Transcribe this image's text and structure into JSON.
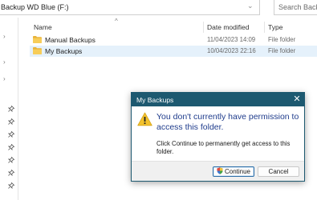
{
  "address": {
    "path": "Backup WD Blue (F:)",
    "dropdown_icon": "chevron-down-icon"
  },
  "search": {
    "placeholder": "Search Backup"
  },
  "columns": {
    "name": "Name",
    "date": "Date modified",
    "type": "Type"
  },
  "rows": [
    {
      "name": "Manual Backups",
      "date": "11/04/2023 14:09",
      "type": "File folder",
      "icon": "folder-icon"
    },
    {
      "name": "My Backups",
      "date": "10/04/2023 22:16",
      "type": "File folder",
      "icon": "folder-icon",
      "selected": true
    }
  ],
  "dialog": {
    "title": "My Backups",
    "main_text": "You don't currently have permission to access this folder.",
    "body_text": "Click Continue to permanently get access to this folder.",
    "continue_label": "Continue",
    "cancel_label": "Cancel",
    "close_glyph": "✕"
  },
  "colors": {
    "dialog_title_bar": "#1d5970",
    "main_text": "#1f3c8c",
    "selection": "#e5f1fb",
    "folder": "#f2c04a"
  }
}
